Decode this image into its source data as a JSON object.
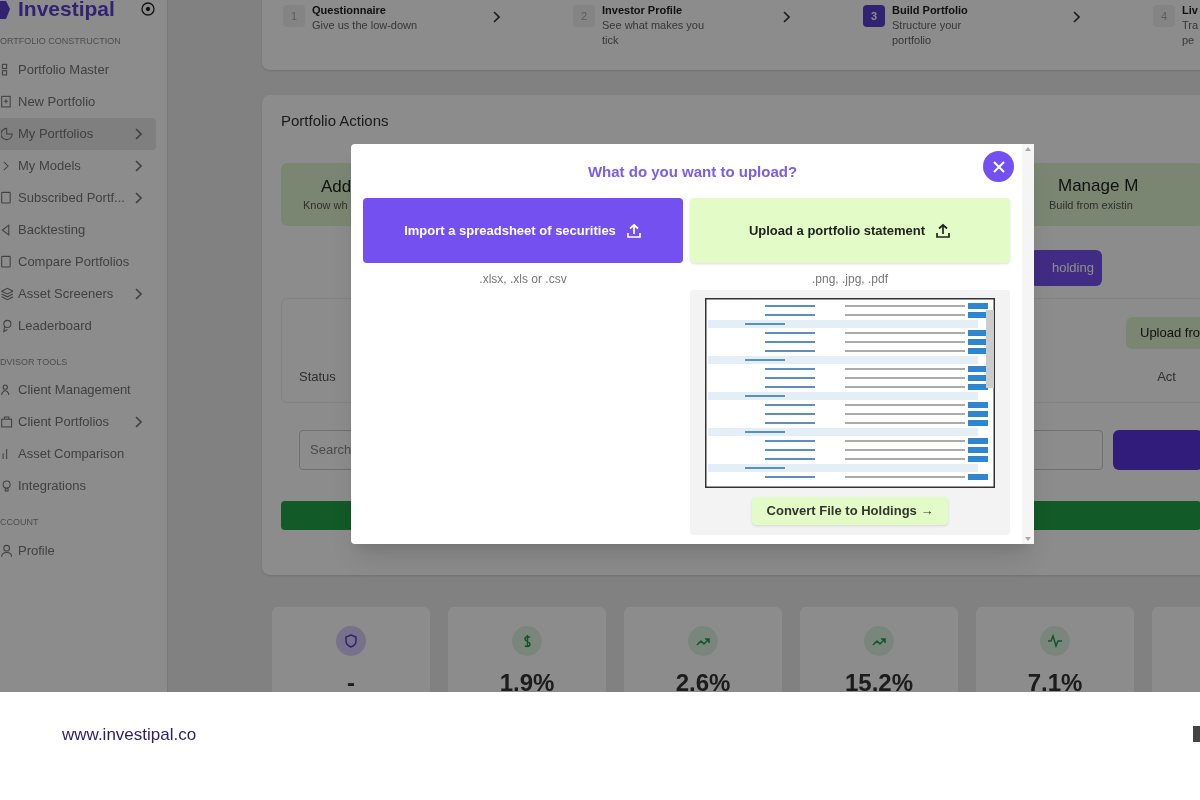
{
  "sidebar": {
    "brand": "Investipal",
    "sections": [
      {
        "heading": "ORTFOLIO CONSTRUCTION",
        "items": [
          {
            "label": "Portfolio Master",
            "has_submenu": false,
            "selected": false
          },
          {
            "label": "New Portfolio",
            "has_submenu": false,
            "selected": false
          },
          {
            "label": "My Portfolios",
            "has_submenu": true,
            "selected": true
          },
          {
            "label": "My Models",
            "has_submenu": true,
            "selected": false
          },
          {
            "label": "Subscribed Portf...",
            "has_submenu": true,
            "selected": false
          },
          {
            "label": "Backtesting",
            "has_submenu": false,
            "selected": false
          },
          {
            "label": "Compare Portfolios",
            "has_submenu": false,
            "selected": false
          },
          {
            "label": "Asset Screeners",
            "has_submenu": true,
            "selected": false
          },
          {
            "label": "Leaderboard",
            "has_submenu": false,
            "selected": false
          }
        ]
      },
      {
        "heading": "DVISOR TOOLS",
        "items": [
          {
            "label": "Client Management",
            "has_submenu": false,
            "selected": false
          },
          {
            "label": "Client Portfolios",
            "has_submenu": true,
            "selected": false
          },
          {
            "label": "Asset Comparison",
            "has_submenu": false,
            "selected": false
          },
          {
            "label": "Integrations",
            "has_submenu": false,
            "selected": false
          }
        ]
      },
      {
        "heading": "CCOUNT",
        "items": [
          {
            "label": "Profile",
            "has_submenu": false,
            "selected": false
          }
        ]
      }
    ]
  },
  "steps": [
    {
      "number": "1",
      "title": "Questionnaire",
      "description": "Give us the low-down",
      "selected": false
    },
    {
      "number": "2",
      "title": "Investor Profile",
      "description": "See what makes you tick",
      "selected": false
    },
    {
      "number": "3",
      "title": "Build Portfolio",
      "description": "Structure your portfolio",
      "selected": true
    },
    {
      "number": "4",
      "title": "Liv",
      "description": "Tra pe",
      "selected": false
    }
  ],
  "portfolio_actions": {
    "title": "Portfolio Actions",
    "action_cards": [
      {
        "title": "Add",
        "subtitle": "Know wh"
      },
      {
        "title": "Manage M",
        "subtitle": "Build from existin"
      }
    ],
    "holding_button": "holding",
    "upload_button": "Upload fro",
    "status_label": "Status",
    "actions_label": "Act",
    "search": {
      "placeholder": "Search"
    }
  },
  "stats": [
    {
      "value": "-",
      "kind": "shield"
    },
    {
      "value": "1.9%",
      "kind": "dollar"
    },
    {
      "value": "2.6%",
      "kind": "trend"
    },
    {
      "value": "15.2%",
      "kind": "trend"
    },
    {
      "value": "7.1%",
      "kind": "pulse"
    }
  ],
  "modal": {
    "title": "What do you want to upload?",
    "options": [
      {
        "label": "Import a spreadsheet of securities",
        "formats": ".xlsx, .xls or .csv",
        "kind": "spreadsheet"
      },
      {
        "label": "Upload a portfolio statement",
        "formats": ".png, .jpg, .pdf",
        "kind": "statement"
      }
    ],
    "convert_button": "Convert File to Holdings →"
  },
  "footer": {
    "url": "www.investipal.co"
  }
}
